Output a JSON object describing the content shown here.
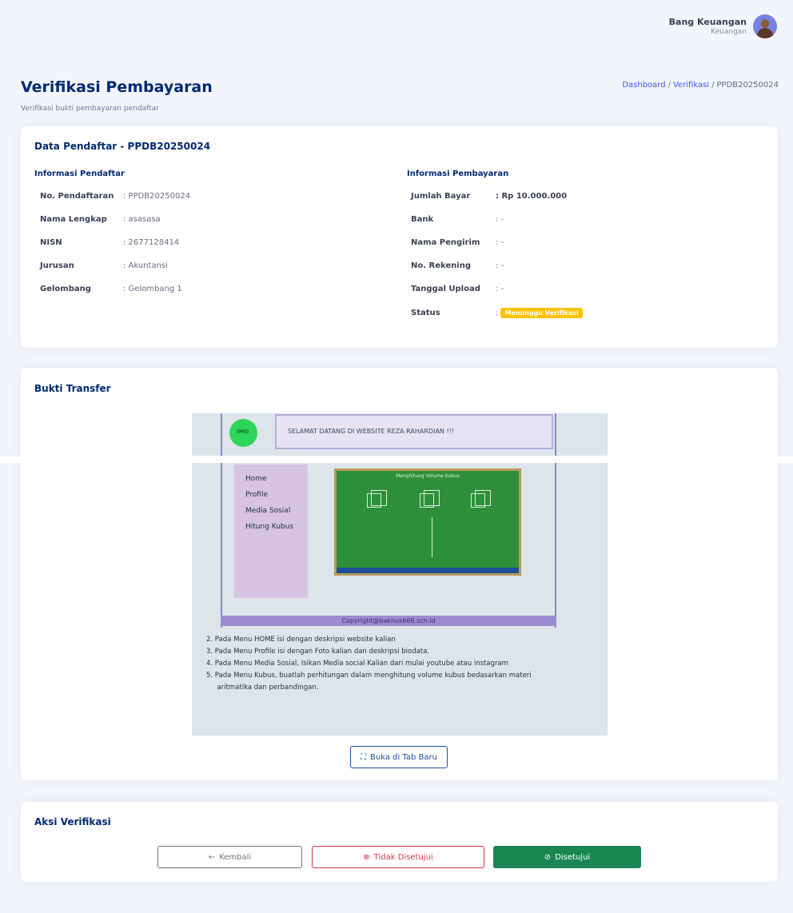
{
  "header": {
    "user_name": "Bang Keuangan",
    "user_role": "Keuangan"
  },
  "page": {
    "title": "Verifikasi Pembayaran",
    "subtitle": "Verifikasi bukti pembayaran pendaftar"
  },
  "breadcrumb": {
    "items": [
      "Dashboard",
      "Verifikasi",
      "PPDB20250024"
    ]
  },
  "registrant_card": {
    "title": "Data Pendaftar - PPDB20250024",
    "registrant_info": {
      "title": "Informasi Pendaftar",
      "rows": [
        {
          "label": "No. Pendaftaran",
          "value": ": PPDB20250024"
        },
        {
          "label": "Nama Lengkap",
          "value": ": asasasa"
        },
        {
          "label": "NISN",
          "value": ": 2677128414"
        },
        {
          "label": "Jurusan",
          "value": ": Akuntansi"
        },
        {
          "label": "Gelombang",
          "value": ": Gelombang 1"
        }
      ]
    },
    "payment_info": {
      "title": "Informasi Pembayaran",
      "rows": [
        {
          "label": "Jumlah Bayar",
          "value": ": Rp 10.000.000"
        },
        {
          "label": "Bank",
          "value": ": -"
        },
        {
          "label": "Nama Pengirim",
          "value": ": -"
        },
        {
          "label": "No. Rekening",
          "value": ": -"
        },
        {
          "label": "Tanggal Upload",
          "value": ": -"
        }
      ],
      "status_label": "Status",
      "status_prefix": ":",
      "status_value": "Menunggu Verifikasi",
      "status_color": "#ffc107"
    }
  },
  "proof_card": {
    "title": "Bukti Transfer",
    "open_button_label": "Buka di Tab Baru",
    "open_button_icon": "fullscreen-icon",
    "image": {
      "badge_text": "IMG",
      "header_text": "SELAMAT DATANG DI WEBSITE REZA RAHARDIAN !!!",
      "menu_items": [
        "Home",
        "Profile",
        "Media Sosial",
        "Hitung Kubus"
      ],
      "board_title": "Menghitung Volume Kubus",
      "footer_text": "Copyright@baknus666.sch.id",
      "instructions": [
        "2.  Pada Menu HOME isi dengan deskripsi website kalian",
        "3.  Pada Menu Profile isi dengan Foto kalian dan deskripsi biodata.",
        "4.  Pada Menu Media Sosial, Isikan Media social Kalian dari mulai youtube atau instagram",
        "5.  Pada Menu Kubus, buatlah perhitungan dalam menghitung volume kubus bedasarkan materi",
        "     aritmatika dan perbandingan."
      ]
    }
  },
  "action_card": {
    "title": "Aksi Verifikasi",
    "back_label": "Kembali",
    "reject_label": "Tidak Disetujui",
    "approve_label": "Disetujui",
    "colors": {
      "back": "#6c757d",
      "reject": "#dc3545",
      "approve": "#198754"
    }
  },
  "theme": {
    "primary": "#012970",
    "link": "#4154f1",
    "background": "#f2f5fb"
  }
}
